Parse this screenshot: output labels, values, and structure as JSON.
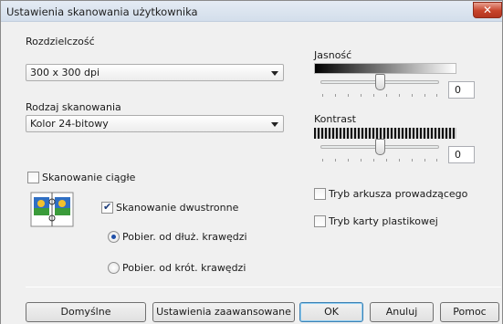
{
  "window": {
    "title": "Ustawienia skanowania użytkownika",
    "close_symbol": "✕"
  },
  "resolution": {
    "label": "Rozdzielczość",
    "value": "300 x 300 dpi"
  },
  "scan_type": {
    "label": "Rodzaj skanowania",
    "value": "Kolor 24-bitowy"
  },
  "continuous_scan": {
    "label": "Skanowanie ciągłe",
    "checked": false
  },
  "duplex": {
    "label": "Skanowanie dwustronne",
    "checked": true,
    "icon": "duplex-book-icon",
    "options": [
      {
        "label": "Pobier. od dłuż. krawędzi",
        "selected": true
      },
      {
        "label": "Pobier. od krót. krawędzi",
        "selected": false
      }
    ]
  },
  "brightness": {
    "label": "Jasność",
    "value": "0",
    "level": 0.5
  },
  "contrast": {
    "label": "Kontrast",
    "value": "0",
    "level": 0.5
  },
  "carrier_sheet": {
    "label": "Tryb arkusza prowadzącego",
    "checked": false
  },
  "plastic_card": {
    "label": "Tryb karty plastikowej",
    "checked": false
  },
  "buttons": {
    "default": "Domyślne",
    "advanced": "Ustawienia zaawansowane",
    "ok": "OK",
    "cancel": "Anuluj",
    "help": "Pomoc"
  },
  "colors": {
    "accent": "#3c7fb1",
    "close": "#c7432b"
  }
}
